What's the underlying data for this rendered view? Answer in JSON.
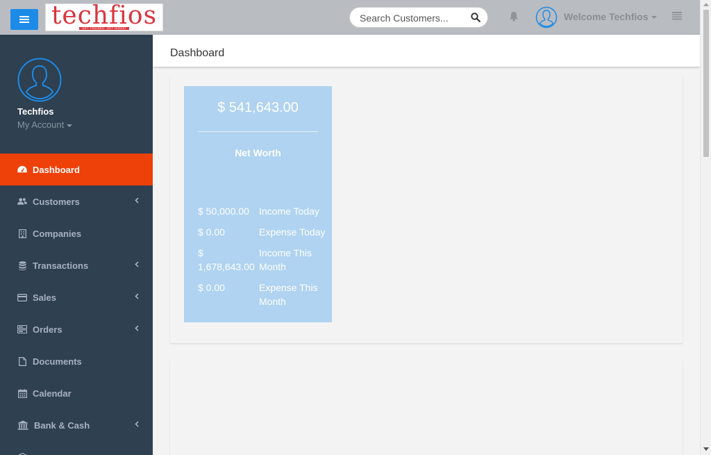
{
  "topbar": {
    "logo_text": "techfios",
    "logo_tagline": "GET TRAINED. GET HIRED!",
    "search_placeholder": "Search Customers...",
    "welcome": "Welcome Techfios"
  },
  "sidebar": {
    "profile_name": "Techfios",
    "my_account": "My Account",
    "items": [
      {
        "label": "Dashboard",
        "icon": "dashboard-icon",
        "active": true
      },
      {
        "label": "Customers",
        "icon": "users-icon",
        "has_submenu": true
      },
      {
        "label": "Companies",
        "icon": "building-icon"
      },
      {
        "label": "Transactions",
        "icon": "database-icon",
        "has_submenu": true
      },
      {
        "label": "Sales",
        "icon": "credit-card-icon",
        "has_submenu": true
      },
      {
        "label": "Orders",
        "icon": "server-icon",
        "has_submenu": true
      },
      {
        "label": "Documents",
        "icon": "file-icon"
      },
      {
        "label": "Calendar",
        "icon": "calendar-icon"
      },
      {
        "label": "Bank & Cash",
        "icon": "bank-icon",
        "has_submenu": true
      }
    ]
  },
  "page": {
    "title": "Dashboard"
  },
  "stats": {
    "amount": "$ 541,643.00",
    "label": "Net Worth",
    "rows": [
      {
        "value": "$ 50,000.00",
        "label": "Income Today"
      },
      {
        "value": "$ 0.00",
        "label": "Expense Today"
      },
      {
        "value": "$ 1,678,643.00",
        "label": "Income This Month"
      },
      {
        "value": "$ 0.00",
        "label": "Expense This Month"
      }
    ]
  },
  "colors": {
    "topbar": "#b9bcc1",
    "sidebar": "#2f4050",
    "active_item": "#ee4109",
    "menu_button": "#1c8be8",
    "stat_card": "#afd3f0"
  }
}
